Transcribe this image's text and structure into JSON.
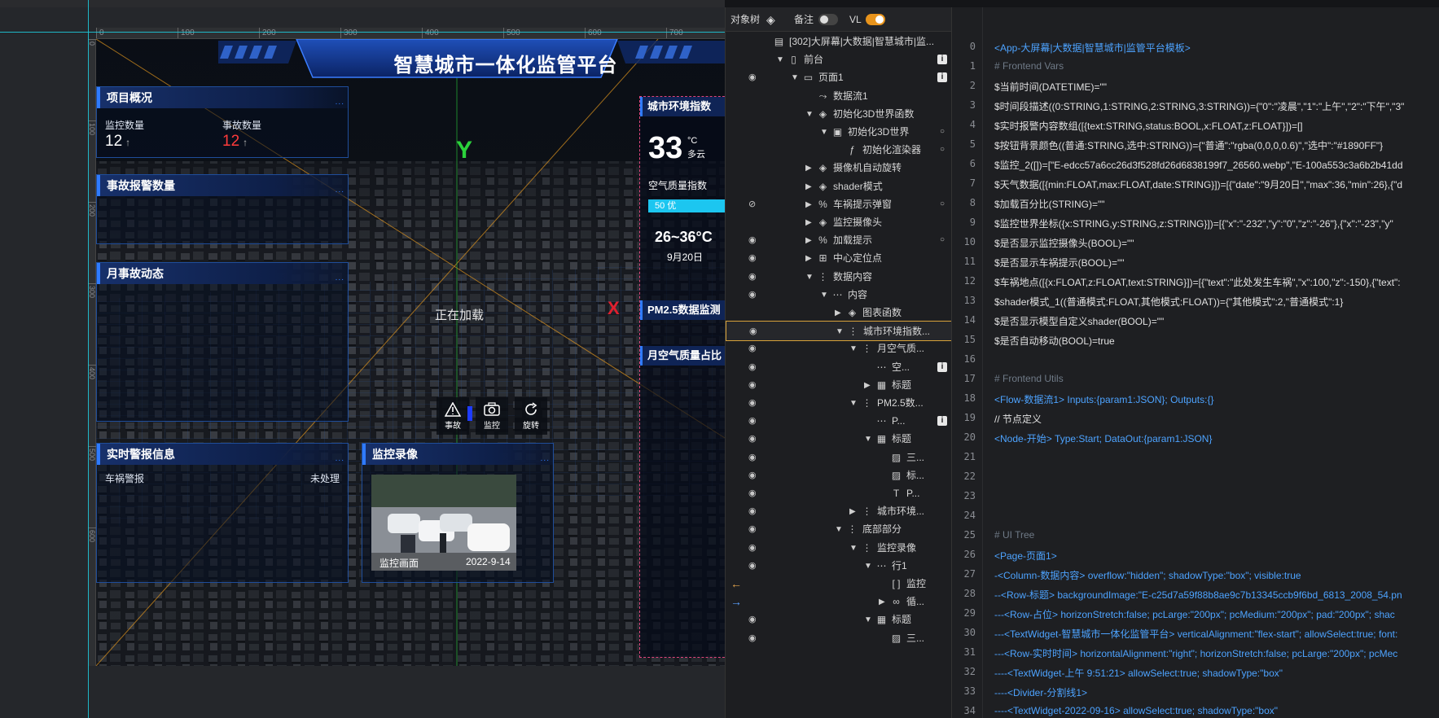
{
  "canvas": {
    "ruler_top": [
      "0",
      "100",
      "200",
      "300",
      "400",
      "500",
      "600",
      "700"
    ],
    "ruler_left": [
      "0",
      "100",
      "200",
      "300",
      "400",
      "500",
      "600"
    ],
    "title": "智慧城市一体化监管平台",
    "overview": {
      "title": "项目概况",
      "monitor_label": "监控数量",
      "monitor_value": "12",
      "accident_label": "事故数量",
      "accident_value": "12",
      "up_arrow": "↑"
    },
    "panel_alarm_count": "事故报警数量",
    "panel_monthly": "月事故动态",
    "panel_realtime": {
      "title": "实时警报信息",
      "item_label": "车祸警报",
      "item_status": "未处理"
    },
    "panel_video": {
      "title": "监控录像",
      "caption": "监控画面",
      "date": "2022-9-14"
    },
    "more_dots": "...",
    "env": {
      "title": "城市环境指数",
      "temp": "33",
      "unit": "°C",
      "weather": "多云",
      "aq_label": "空气质量指数",
      "aq_value": "50 优",
      "range": "26~36°C",
      "date": "9月20日",
      "pm_title": "PM2.5数据监测",
      "month_aq": "月空气质量占比"
    },
    "loading": "正在加载",
    "axis_y": "Y",
    "axis_x": "X",
    "tools": [
      {
        "label": "事故",
        "icon": "warning-icon"
      },
      {
        "label": "监控",
        "icon": "camera-icon"
      },
      {
        "label": "旋转",
        "icon": "rotate-icon"
      }
    ]
  },
  "tree": {
    "header": {
      "title": "对象树",
      "notes": "备注",
      "vl": "VL",
      "notes_on": false,
      "vl_on": true
    },
    "rows": [
      {
        "name": "[302]大屏幕|大数据|智慧城市|监...",
        "indent": 0,
        "icon": "app-icon",
        "eye": false,
        "caret": "",
        "badge": ""
      },
      {
        "name": "前台",
        "indent": 1,
        "icon": "phone-icon",
        "eye": false,
        "caret": "down",
        "badge": "box"
      },
      {
        "name": "页面1",
        "indent": 2,
        "icon": "page-icon",
        "eye": true,
        "caret": "down",
        "badge": "box"
      },
      {
        "name": "数据流1",
        "indent": 3,
        "icon": "flow-icon",
        "eye": false,
        "caret": "",
        "badge": ""
      },
      {
        "name": "初始化3D世界函数",
        "indent": 3,
        "icon": "cube-icon",
        "eye": false,
        "caret": "down",
        "badge": ""
      },
      {
        "name": "初始化3D世界",
        "indent": 4,
        "icon": "world-icon",
        "eye": false,
        "caret": "down",
        "badge": "dot"
      },
      {
        "name": "初始化渲染器",
        "indent": 5,
        "icon": "function-icon",
        "eye": false,
        "caret": "",
        "badge": "dot"
      },
      {
        "name": "摄像机自动旋转",
        "indent": 3,
        "icon": "cube-icon",
        "eye": false,
        "caret": "right",
        "badge": ""
      },
      {
        "name": "shader模式",
        "indent": 3,
        "icon": "cube-icon",
        "eye": false,
        "caret": "right",
        "badge": ""
      },
      {
        "name": "车祸提示弹窗",
        "indent": 3,
        "icon": "percent-icon",
        "eye": "hidden",
        "caret": "right",
        "badge": "dot"
      },
      {
        "name": "监控摄像头",
        "indent": 3,
        "icon": "cube-icon",
        "eye": false,
        "caret": "right",
        "badge": ""
      },
      {
        "name": "加载提示",
        "indent": 3,
        "icon": "percent-icon",
        "eye": true,
        "caret": "right",
        "badge": "dot"
      },
      {
        "name": "中心定位点",
        "indent": 3,
        "icon": "px-icon",
        "eye": true,
        "caret": "right",
        "badge": ""
      },
      {
        "name": "数据内容",
        "indent": 3,
        "icon": "column-icon",
        "eye": true,
        "caret": "down",
        "badge": ""
      },
      {
        "name": "内容",
        "indent": 4,
        "icon": "row-icon",
        "eye": true,
        "caret": "down",
        "badge": ""
      },
      {
        "name": "图表函数",
        "indent": 5,
        "icon": "cube-icon",
        "eye": false,
        "caret": "right",
        "badge": ""
      },
      {
        "name": "城市环境指数...",
        "indent": 5,
        "icon": "column-icon",
        "eye": true,
        "caret": "down",
        "badge": "",
        "selected": true
      },
      {
        "name": "月空气质...",
        "indent": 6,
        "icon": "column-icon",
        "eye": true,
        "caret": "down",
        "badge": ""
      },
      {
        "name": "空...",
        "indent": 7,
        "icon": "row-icon",
        "eye": true,
        "caret": "",
        "badge": "box"
      },
      {
        "name": "标题",
        "indent": 7,
        "icon": "image-group-icon",
        "eye": true,
        "caret": "right",
        "badge": ""
      },
      {
        "name": "PM2.5数...",
        "indent": 6,
        "icon": "column-icon",
        "eye": true,
        "caret": "down",
        "badge": ""
      },
      {
        "name": "P...",
        "indent": 7,
        "icon": "row-icon",
        "eye": true,
        "caret": "",
        "badge": "box"
      },
      {
        "name": "标题",
        "indent": 7,
        "icon": "image-group-icon",
        "eye": true,
        "caret": "down",
        "badge": ""
      },
      {
        "name": "三...",
        "indent": 8,
        "icon": "image-icon",
        "eye": true,
        "caret": "",
        "badge": ""
      },
      {
        "name": "标...",
        "indent": 8,
        "icon": "image-icon",
        "eye": true,
        "caret": "",
        "badge": ""
      },
      {
        "name": "P...",
        "indent": 8,
        "icon": "text-icon",
        "eye": true,
        "caret": "",
        "badge": ""
      },
      {
        "name": "城市环境...",
        "indent": 6,
        "icon": "column-icon",
        "eye": true,
        "caret": "right",
        "badge": ""
      },
      {
        "name": "底部部分",
        "indent": 5,
        "icon": "column-icon",
        "eye": true,
        "caret": "down",
        "badge": ""
      },
      {
        "name": "监控录像",
        "indent": 6,
        "icon": "column-icon",
        "eye": true,
        "caret": "down",
        "badge": ""
      },
      {
        "name": "行1",
        "indent": 7,
        "icon": "row-icon",
        "eye": true,
        "caret": "down",
        "badge": ""
      },
      {
        "name": "监控",
        "indent": 8,
        "icon": "bracket-icon",
        "eye": "arrow-left",
        "caret": "",
        "badge": ""
      },
      {
        "name": "循...",
        "indent": 8,
        "icon": "for-icon",
        "eye": "arrow-right",
        "caret": "right",
        "badge": ""
      },
      {
        "name": "标题",
        "indent": 7,
        "icon": "image-group-icon",
        "eye": true,
        "caret": "down",
        "badge": ""
      },
      {
        "name": "三...",
        "indent": 8,
        "icon": "image-icon",
        "eye": true,
        "caret": "",
        "badge": ""
      }
    ]
  },
  "code": {
    "line_numbers": [
      "0",
      "1",
      "2",
      "3",
      "4",
      "5",
      "6",
      "7",
      "8",
      "9",
      "10",
      "11",
      "12",
      "13",
      "14",
      "15",
      "16",
      "17",
      "18",
      "19",
      "20",
      "21",
      "22",
      "23",
      "24",
      "25",
      "26",
      "27",
      "28",
      "29",
      "30",
      "31",
      "32",
      "33",
      "34"
    ],
    "lines": [
      {
        "n": 0,
        "t": "<App-大屏幕|大数据|智慧城市|监管平台模板>",
        "c": "tag"
      },
      {
        "n": 1,
        "t": "# Frontend Vars",
        "c": "com"
      },
      {
        "n": 2,
        "t": "$当前时间(DATETIME)=\"\"",
        "c": "txt"
      },
      {
        "n": 3,
        "t": "$时间段描述((0:STRING,1:STRING,2:STRING,3:STRING))={\"0\":\"凌晨\",\"1\":\"上午\",\"2\":\"下午\",\"3\"",
        "c": "txt"
      },
      {
        "n": 4,
        "t": "$实时报警内容数组([{text:STRING,status:BOOL,x:FLOAT,z:FLOAT}])=[]",
        "c": "txt"
      },
      {
        "n": 5,
        "t": "$按钮背景颜色((普通:STRING,选中:STRING))={\"普通\":\"rgba(0,0,0,0.6)\",\"选中\":\"#1890FF\"}",
        "c": "txt"
      },
      {
        "n": 6,
        "t": "$监控_2([])=[\"E-edcc57a6cc26d3f528fd26d6838199f7_26560.webp\",\"E-100a553c3a6b2b41dd",
        "c": "txt"
      },
      {
        "n": 7,
        "t": "$天气数据([{min:FLOAT,max:FLOAT,date:STRING}])=[{\"date\":\"9月20日\",\"max\":36,\"min\":26},{\"d",
        "c": "txt"
      },
      {
        "n": 8,
        "t": "$加载百分比(STRING)=\"\"",
        "c": "txt"
      },
      {
        "n": 9,
        "t": "$监控世界坐标({x:STRING,y:STRING,z:STRING}])=[{\"x\":\"-232\",\"y\":\"0\",\"z\":\"-26\"},{\"x\":\"-23\",\"y\"",
        "c": "txt"
      },
      {
        "n": 10,
        "t": "$是否显示监控摄像头(BOOL)=\"\"",
        "c": "txt"
      },
      {
        "n": 11,
        "t": "$是否显示车祸提示(BOOL)=\"\"",
        "c": "txt"
      },
      {
        "n": 12,
        "t": "$车祸地点([{x:FLOAT,z:FLOAT,text:STRING}])=[{\"text\":\"此处发生车祸\",\"x\":100,\"z\":-150},{\"text\":",
        "c": "txt"
      },
      {
        "n": 13,
        "t": "$shader模式_1((普通模式:FLOAT,其他模式:FLOAT))={\"其他模式\":2,\"普通模式\":1}",
        "c": "txt"
      },
      {
        "n": 14,
        "t": "$是否显示模型自定义shader(BOOL)=\"\"",
        "c": "txt"
      },
      {
        "n": 15,
        "t": "$是否自动移动(BOOL)=true",
        "c": "txt"
      },
      {
        "n": 16,
        "t": "",
        "c": "txt"
      },
      {
        "n": 17,
        "t": "# Frontend Utils",
        "c": "com"
      },
      {
        "n": 18,
        "t": "<Flow-数据流1> Inputs:{param1:JSON}; Outputs:{}",
        "c": "tag"
      },
      {
        "n": 19,
        "t": "// 节点定义",
        "c": "txt"
      },
      {
        "n": 20,
        "t": "<Node-开始> Type:Start; DataOut:{param1:JSON}",
        "c": "tag"
      },
      {
        "n": 21,
        "t": "",
        "c": "txt"
      },
      {
        "n": 22,
        "t": "",
        "c": "txt"
      },
      {
        "n": 23,
        "t": "",
        "c": "txt"
      },
      {
        "n": 24,
        "t": "",
        "c": "txt"
      },
      {
        "n": 25,
        "t": "# UI Tree",
        "c": "com"
      },
      {
        "n": 26,
        "t": "<Page-页面1>",
        "c": "tag"
      },
      {
        "n": 27,
        "t": "-<Column-数据内容> overflow:\"hidden\"; shadowType:\"box\"; visible:true",
        "c": "tag"
      },
      {
        "n": 28,
        "t": "--<Row-标题> backgroundImage:\"E-c25d7a59f88b8ae9c7b13345ccb9f6bd_6813_2008_54.pn",
        "c": "tag"
      },
      {
        "n": 29,
        "t": "---<Row-占位> horizonStretch:false; pcLarge:\"200px\"; pcMedium:\"200px\"; pad:\"200px\"; shac",
        "c": "tag"
      },
      {
        "n": 30,
        "t": "---<TextWidget-智慧城市一体化监管平台> verticalAlignment:\"flex-start\"; allowSelect:true; font:",
        "c": "tag"
      },
      {
        "n": 31,
        "t": "---<Row-实时时间> horizontalAlignment:\"right\"; horizonStretch:false; pcLarge:\"200px\"; pcMec",
        "c": "tag"
      },
      {
        "n": 32,
        "t": "----<TextWidget-上午 9:51:21> allowSelect:true; shadowType:\"box\"",
        "c": "tag"
      },
      {
        "n": 33,
        "t": "----<Divider-分割线1>",
        "c": "tag"
      },
      {
        "n": 34,
        "t": "----<TextWidget-2022-09-16> allowSelect:true; shadowType:\"box\"",
        "c": "tag"
      }
    ]
  }
}
